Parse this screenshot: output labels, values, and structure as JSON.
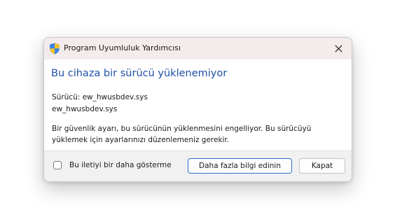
{
  "titlebar": {
    "icon": "shield-icon",
    "title": "Program Uyumluluk Yardımcısı",
    "close_icon": "close-icon"
  },
  "content": {
    "heading": "Bu cihaza bir sürücü yüklenemiyor",
    "driver_line": "Sürücü: ew_hwusbdev.sys",
    "driver_name": "ew_hwusbdev.sys",
    "body_line1": "Bir güvenlik ayarı, bu sürücünün yüklenmesini engelliyor. Bu sürücüyü",
    "body_line2": "yüklemek için ayarlarınızı düzenlemeniz gerekir."
  },
  "footer": {
    "checkbox_label": "Bu iletiyi bir daha gösterme",
    "checkbox_checked": false,
    "more_info_label": "Daha fazla bilgi edinin",
    "close_label": "Kapat"
  },
  "colors": {
    "heading": "#1f4fa6",
    "titlebar_bg": "#f4ecec",
    "footer_bg": "#f1f1f1",
    "primary_border": "#2a6fc9"
  }
}
